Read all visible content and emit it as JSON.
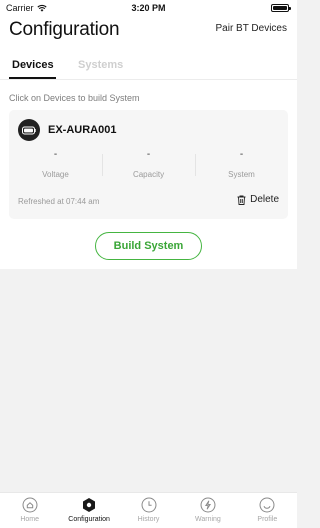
{
  "status_bar": {
    "carrier": "Carrier",
    "time": "3:20 PM"
  },
  "header": {
    "title": "Configuration",
    "pair_label": "Pair BT Devices"
  },
  "tabs": [
    {
      "label": "Devices",
      "active": true
    },
    {
      "label": "Systems",
      "active": false
    }
  ],
  "hint": "Click on Devices to build System",
  "device": {
    "name": "EX-AURA001",
    "stats": [
      {
        "label": "Voltage",
        "value": "-"
      },
      {
        "label": "Capacity",
        "value": "-"
      },
      {
        "label": "System",
        "value": "-"
      }
    ],
    "refreshed": "Refreshed at 07:44 am",
    "delete_label": "Delete"
  },
  "build_label": "Build System",
  "nav": [
    {
      "label": "Home",
      "icon": "home-icon",
      "active": false
    },
    {
      "label": "Configuration",
      "icon": "configuration-icon",
      "active": true
    },
    {
      "label": "History",
      "icon": "history-icon",
      "active": false
    },
    {
      "label": "Warning",
      "icon": "warning-icon",
      "active": false
    },
    {
      "label": "Profile",
      "icon": "profile-icon",
      "active": false
    }
  ],
  "colors": {
    "accent": "#45b541",
    "text": "#111111",
    "muted": "#9a9a9a",
    "inactive_tab": "#cfcfcf"
  }
}
